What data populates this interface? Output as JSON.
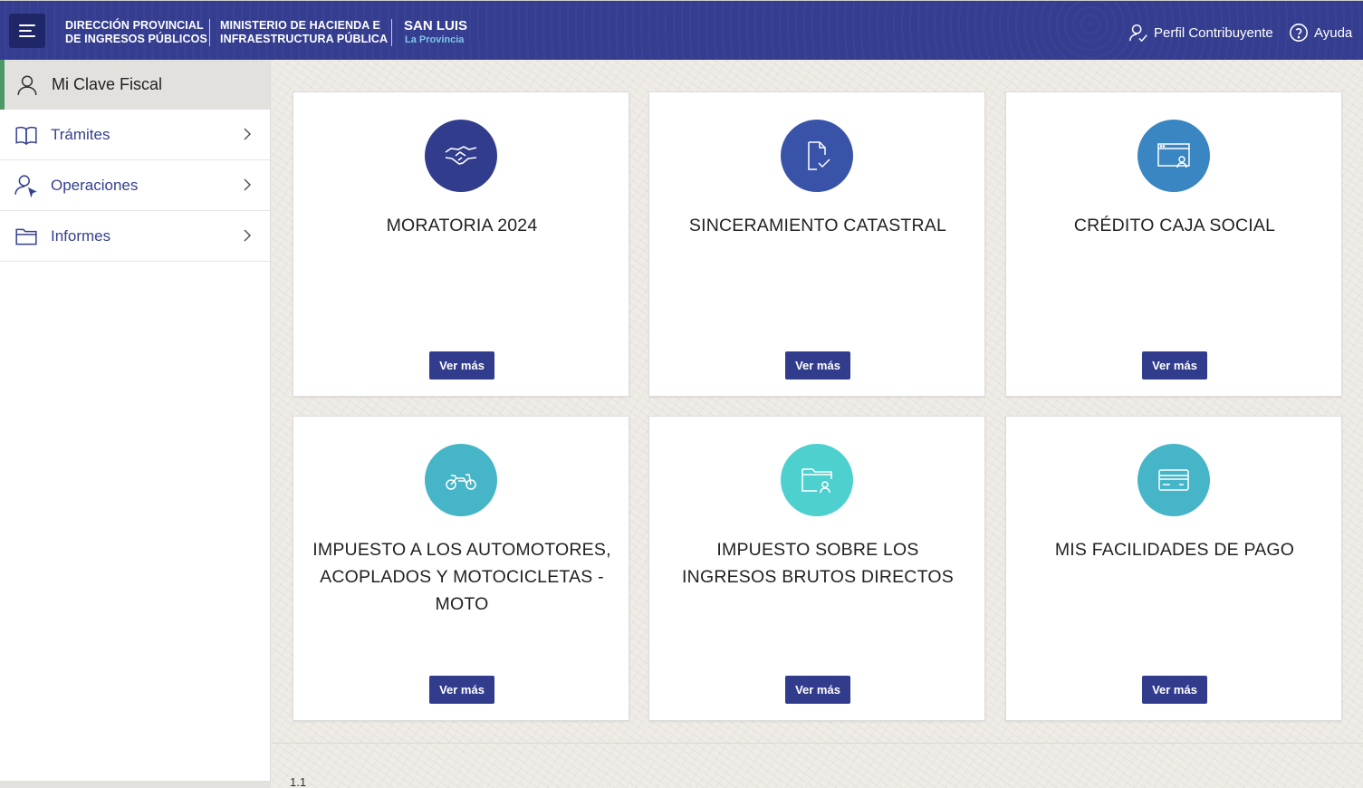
{
  "header": {
    "brand1_line1": "DIRECCIÓN PROVINCIAL",
    "brand1_line2": "DE INGRESOS PÚBLICOS",
    "brand2_line1": "MINISTERIO DE HACIENDA E",
    "brand2_line2": "INFRAESTRUCTURA PÚBLICA",
    "brand3_title": "SAN LUIS",
    "brand3_sub": "La Provincia",
    "profile_label": "Perfil Contribuyente",
    "help_label": "Ayuda",
    "background_color": "#343d8f"
  },
  "sidebar": {
    "active_label": "Mi Clave Fiscal",
    "active_icon": "user-icon",
    "items": [
      {
        "label": "Trámites",
        "icon": "book-icon"
      },
      {
        "label": "Operaciones",
        "icon": "user-pointer-icon"
      },
      {
        "label": "Informes",
        "icon": "folder-icon"
      }
    ]
  },
  "cards": [
    {
      "title": "MORATORIA 2024",
      "icon": "handshake-icon",
      "color": "#313c8c",
      "button": "Ver más"
    },
    {
      "title": "SINCERAMIENTO CATASTRAL",
      "icon": "document-check-icon",
      "color": "#3953a8",
      "button": "Ver más"
    },
    {
      "title": "CRÉDITO CAJA SOCIAL",
      "icon": "browser-user-icon",
      "color": "#3a86c2",
      "button": "Ver más"
    },
    {
      "title": "IMPUESTO A LOS AUTOMOTORES, ACOPLADOS Y MOTOCICLETAS - MOTO",
      "icon": "motorcycle-icon",
      "color": "#45b5c7",
      "button": "Ver más"
    },
    {
      "title": "IMPUESTO SOBRE LOS INGRESOS BRUTOS DIRECTOS",
      "icon": "folder-user-icon",
      "color": "#4ed0cf",
      "button": "Ver más"
    },
    {
      "title": "MIS FACILIDADES DE PAGO",
      "icon": "credit-card-icon",
      "color": "#45b5c7",
      "button": "Ver más"
    }
  ],
  "footer": {
    "version": "1.1"
  }
}
